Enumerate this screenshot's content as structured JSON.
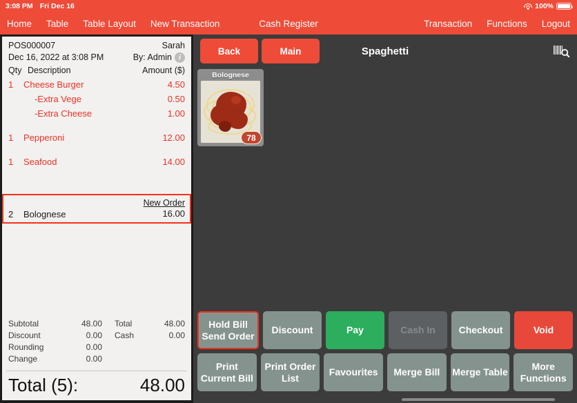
{
  "statusbar": {
    "time": "3:08 PM",
    "date": "Fri Dec 16",
    "battery": "100%",
    "wifi_icon": "wifi-icon",
    "battery_icon": "battery-icon"
  },
  "navbar": {
    "title": "Cash Register",
    "left": [
      {
        "label": "Home",
        "name": "nav-home"
      },
      {
        "label": "Table",
        "name": "nav-table"
      },
      {
        "label": "Table Layout",
        "name": "nav-table-layout"
      },
      {
        "label": "New Transaction",
        "name": "nav-new-transaction"
      }
    ],
    "right": [
      {
        "label": "Transaction",
        "name": "nav-transaction"
      },
      {
        "label": "Functions",
        "name": "nav-functions"
      },
      {
        "label": "Logout",
        "name": "nav-logout"
      }
    ]
  },
  "receipt": {
    "order_no": "POS000007",
    "cashier": "Sarah",
    "datetime": "Dec 16, 2022 at 3:08 PM",
    "by": "By: Admin",
    "info_icon": "info-icon",
    "columns": {
      "qty": "Qty",
      "description": "Description",
      "amount": "Amount ($)"
    },
    "items": [
      {
        "qty": "1",
        "desc": "Cheese Burger",
        "amount": "4.50",
        "modifier": false,
        "selected": false
      },
      {
        "qty": "",
        "desc": "-Extra Vege",
        "amount": "0.50",
        "modifier": true,
        "selected": false
      },
      {
        "qty": "",
        "desc": "-Extra Cheese",
        "amount": "1.00",
        "modifier": true,
        "selected": false
      },
      {
        "qty": "1",
        "desc": "Pepperoni",
        "amount": "12.00",
        "modifier": false,
        "selected": false
      },
      {
        "qty": "1",
        "desc": "Seafood",
        "amount": "14.00",
        "modifier": false,
        "selected": false
      },
      {
        "qty": "2",
        "desc": "Bolognese",
        "amount": "16.00",
        "modifier": false,
        "selected": true,
        "tag": "New Order"
      }
    ],
    "totals": [
      {
        "label": "Subtotal",
        "value": "48.00",
        "label2": "Total",
        "value2": "48.00"
      },
      {
        "label": "Discount",
        "value": "0.00",
        "label2": "Cash",
        "value2": "0.00"
      },
      {
        "label": "Rounding",
        "value": "0.00",
        "label2": "",
        "value2": ""
      },
      {
        "label": "Change",
        "value": "0.00",
        "label2": "",
        "value2": ""
      }
    ],
    "grand_label": "Total (5):",
    "grand_value": "48.00"
  },
  "toolbar": {
    "back_label": "Back",
    "main_label": "Main",
    "category_title": "Spaghetti",
    "search_icon": "barcode-search-icon"
  },
  "products": [
    {
      "name": "Bolognese",
      "badge": "78"
    }
  ],
  "actions": {
    "row1": [
      {
        "label": "Hold Bill\nSend Order",
        "name": "hold-bill-send-order-button",
        "style": "gray",
        "highlighted": true,
        "disabled": false
      },
      {
        "label": "Discount",
        "name": "discount-button",
        "style": "gray",
        "highlighted": false,
        "disabled": false
      },
      {
        "label": "Pay",
        "name": "pay-button",
        "style": "green",
        "highlighted": false,
        "disabled": false
      },
      {
        "label": "Cash In",
        "name": "cash-in-button",
        "style": "gray",
        "highlighted": false,
        "disabled": true
      },
      {
        "label": "Checkout",
        "name": "checkout-button",
        "style": "gray",
        "highlighted": false,
        "disabled": false
      },
      {
        "label": "Void",
        "name": "void-button",
        "style": "red",
        "highlighted": false,
        "disabled": false
      }
    ],
    "row2": [
      {
        "label": "Print\nCurrent Bill",
        "name": "print-current-bill-button",
        "style": "gray",
        "highlighted": false,
        "disabled": false
      },
      {
        "label": "Print Order\nList",
        "name": "print-order-list-button",
        "style": "gray",
        "highlighted": false,
        "disabled": false
      },
      {
        "label": "Favourites",
        "name": "favourites-button",
        "style": "gray",
        "highlighted": false,
        "disabled": false
      },
      {
        "label": "Merge Bill",
        "name": "merge-bill-button",
        "style": "gray",
        "highlighted": false,
        "disabled": false
      },
      {
        "label": "Merge Table",
        "name": "merge-table-button",
        "style": "gray",
        "highlighted": false,
        "disabled": false
      },
      {
        "label": "More\nFunctions",
        "name": "more-functions-button",
        "style": "gray",
        "highlighted": false,
        "disabled": false
      }
    ]
  },
  "colors": {
    "brand_red": "#ee4b38",
    "selection_red": "#f6301c",
    "item_red": "#ee3124",
    "panel_dark": "#3c3c3c",
    "button_gray": "#85938f",
    "button_disabled": "#5c6063",
    "pay_green": "#2cae5e",
    "void_red": "#e8483a",
    "receipt_bg": "#f2f1ef"
  }
}
